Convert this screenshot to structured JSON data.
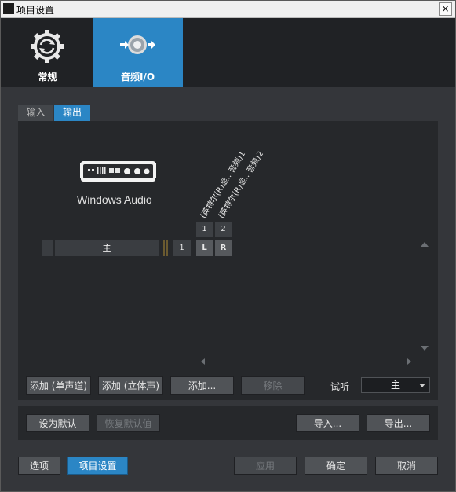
{
  "window": {
    "title": "项目设置",
    "close_glyph": "×"
  },
  "nav": {
    "general_label": "常规",
    "audio_label": "音频I/O"
  },
  "subtabs": {
    "input": "输入",
    "output": "输出"
  },
  "device": {
    "name": "Windows Audio"
  },
  "channels": {
    "labels": [
      "(英特尔(R)显...音频)1",
      "(英特尔(R)显...音频)2"
    ],
    "numbers": [
      "1",
      "2"
    ],
    "lr": [
      "L",
      "R"
    ]
  },
  "track": {
    "name": "主",
    "number": "1"
  },
  "buttons": {
    "add_mono": "添加 (单声道)",
    "add_stereo": "添加 (立体声)",
    "add": "添加...",
    "remove": "移除",
    "set_default": "设为默认",
    "restore_default": "恢复默认值",
    "import": "导入...",
    "export": "导出...",
    "options": "选项",
    "project_settings": "项目设置",
    "apply": "应用",
    "ok": "确定",
    "cancel": "取消"
  },
  "audition": {
    "label": "试听",
    "value": "主"
  },
  "colors": {
    "accent": "#2b86c5",
    "background": "#2e3033",
    "panel": "#26282b"
  }
}
